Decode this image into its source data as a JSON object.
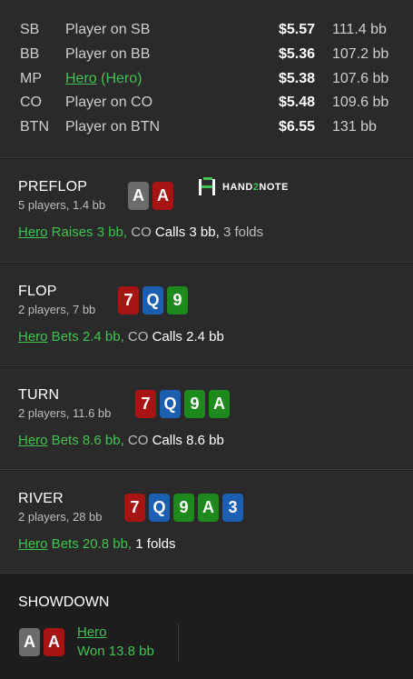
{
  "players": [
    {
      "pos": "SB",
      "name": "Player on SB",
      "hero_name": "",
      "hero_tag": "",
      "amount": "$5.57",
      "bb": "111.4 bb"
    },
    {
      "pos": "BB",
      "name": "Player on BB",
      "hero_name": "",
      "hero_tag": "",
      "amount": "$5.36",
      "bb": "107.2 bb"
    },
    {
      "pos": "MP",
      "name": "",
      "hero_name": "Hero",
      "hero_tag": " (Hero)",
      "amount": "$5.38",
      "bb": "107.6 bb"
    },
    {
      "pos": "CO",
      "name": "Player on CO",
      "hero_name": "",
      "hero_tag": "",
      "amount": "$5.48",
      "bb": "109.6 bb"
    },
    {
      "pos": "BTN",
      "name": "Player on BTN",
      "hero_name": "",
      "hero_tag": "",
      "amount": "$6.55",
      "bb": "131 bb"
    }
  ],
  "logo": {
    "left": "HAND",
    "two": "2",
    "right": "NOTE"
  },
  "preflop": {
    "title": "PREFLOP",
    "sub": "5 players, 1.4 bb",
    "cards": [
      {
        "rank": "A",
        "suit": "spade"
      },
      {
        "rank": "A",
        "suit": "heart"
      }
    ],
    "hero": "Hero",
    "act1": " Raises 3 bb,",
    "p2": " CO",
    "act2": " Calls 3 bb,",
    "folds": " 3 folds"
  },
  "flop": {
    "title": "FLOP",
    "sub": "2 players, 7 bb",
    "cards": [
      {
        "rank": "7",
        "suit": "heart"
      },
      {
        "rank": "Q",
        "suit": "diamond"
      },
      {
        "rank": "9",
        "suit": "club"
      }
    ],
    "hero": "Hero",
    "act1": " Bets 2.4 bb,",
    "p2": " CO",
    "act2": " Calls 2.4 bb"
  },
  "turn": {
    "title": "TURN",
    "sub": "2 players, 11.6 bb",
    "cards": [
      {
        "rank": "7",
        "suit": "heart"
      },
      {
        "rank": "Q",
        "suit": "diamond"
      },
      {
        "rank": "9",
        "suit": "club"
      },
      {
        "rank": "A",
        "suit": "club"
      }
    ],
    "hero": "Hero",
    "act1": " Bets 8.6 bb,",
    "p2": " CO",
    "act2": " Calls 8.6 bb"
  },
  "river": {
    "title": "RIVER",
    "sub": "2 players, 28 bb",
    "cards": [
      {
        "rank": "7",
        "suit": "heart"
      },
      {
        "rank": "Q",
        "suit": "diamond"
      },
      {
        "rank": "9",
        "suit": "club"
      },
      {
        "rank": "A",
        "suit": "club"
      },
      {
        "rank": "3",
        "suit": "diamond"
      }
    ],
    "hero": "Hero",
    "act1": " Bets 20.8 bb,",
    "folds": " 1 folds"
  },
  "showdown": {
    "title": "SHOWDOWN",
    "cards": [
      {
        "rank": "A",
        "suit": "spade"
      },
      {
        "rank": "A",
        "suit": "heart"
      }
    ],
    "winner": "Hero",
    "result": "Won 13.8 bb"
  },
  "colors": {
    "bg": "#2a2a2a",
    "green": "#43c153",
    "spade": "#6b6b6b",
    "heart": "#a71414",
    "diamond": "#1c5fb0",
    "club": "#1e8a1e"
  }
}
